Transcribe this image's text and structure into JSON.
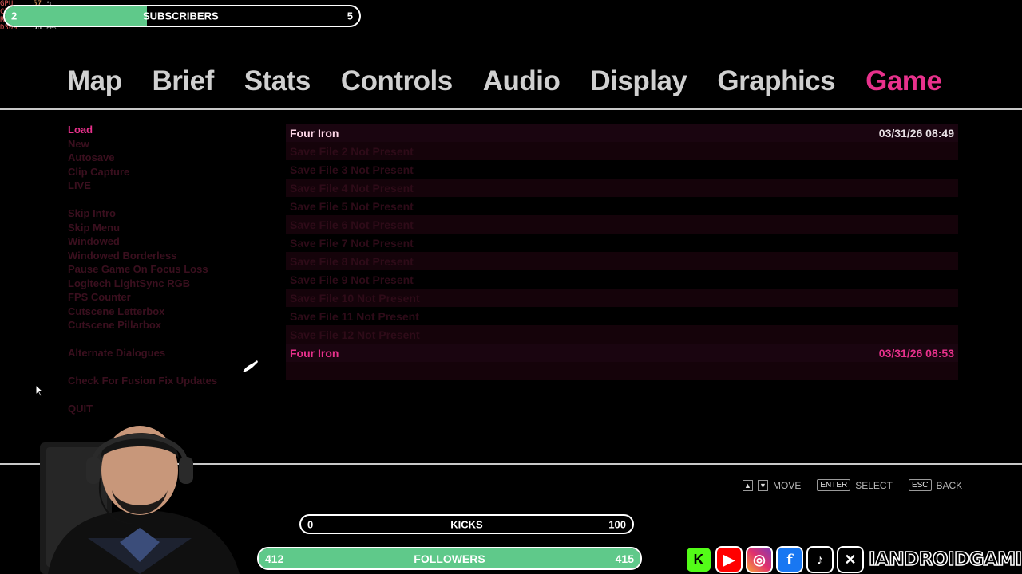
{
  "perf": [
    {
      "label": "GPU",
      "value": "57",
      "unit": "°C"
    },
    {
      "label": "CPU",
      "value": "75",
      "unit": "%"
    },
    {
      "label": "RAM",
      "value": "7518",
      "unit": "MB"
    },
    {
      "label": "D309",
      "value": "58",
      "unit": "FPS"
    }
  ],
  "subscribers": {
    "start": "2",
    "label": "SUBSCRIBERS",
    "end": "5",
    "progress": 0.4
  },
  "tabs": [
    {
      "label": "Map"
    },
    {
      "label": "Brief"
    },
    {
      "label": "Stats"
    },
    {
      "label": "Controls"
    },
    {
      "label": "Audio"
    },
    {
      "label": "Display"
    },
    {
      "label": "Graphics"
    },
    {
      "label": "Game",
      "active": true
    }
  ],
  "menu": {
    "group1": [
      "Load",
      "New",
      "Autosave",
      "Clip Capture",
      "LIVE"
    ],
    "group2": [
      "Skip Intro",
      "Skip Menu",
      "Windowed",
      "Windowed Borderless",
      "Pause Game On Focus Loss",
      "Logitech LightSync RGB",
      "FPS Counter",
      "Cutscene Letterbox",
      "Cutscene Pillarbox"
    ],
    "group3": [
      "Alternate Dialogues"
    ],
    "group4": [
      "Check For Fusion Fix Updates"
    ],
    "group5": [
      "QUIT"
    ]
  },
  "saves": [
    {
      "name": "Four Iron",
      "date": "03/31/26 08:49"
    },
    {
      "name": "Save File 2 Not Present",
      "date": ""
    },
    {
      "name": "Save File 3 Not Present",
      "date": ""
    },
    {
      "name": "Save File 4 Not Present",
      "date": ""
    },
    {
      "name": "Save File 5 Not Present",
      "date": ""
    },
    {
      "name": "Save File 6 Not Present",
      "date": ""
    },
    {
      "name": "Save File 7 Not Present",
      "date": ""
    },
    {
      "name": "Save File 8 Not Present",
      "date": ""
    },
    {
      "name": "Save File 9 Not Present",
      "date": ""
    },
    {
      "name": "Save File 10 Not Present",
      "date": ""
    },
    {
      "name": "Save File 11 Not Present",
      "date": ""
    },
    {
      "name": "Save File 12 Not Present",
      "date": ""
    },
    {
      "name": "Four Iron",
      "date": "03/31/26 08:53"
    },
    {
      "name": "",
      "date": ""
    },
    {
      "name": "",
      "date": ""
    }
  ],
  "hints": {
    "move": "MOVE",
    "enter_key": "ENTER",
    "select": "SELECT",
    "esc_key": "ESC",
    "back": "BACK"
  },
  "kicks": {
    "start": "0",
    "label": "KICKS",
    "end": "100",
    "progress": 0
  },
  "followers": {
    "start": "412",
    "label": "FOLLOWERS",
    "end": "415",
    "progress": 1.0
  },
  "social": {
    "handle": "IANDROIDGAMING",
    "icons": [
      "kick-icon",
      "youtube-icon",
      "instagram-icon",
      "facebook-icon",
      "tiktok-icon",
      "x-icon"
    ]
  },
  "colors": {
    "accent": "#e8318c",
    "goal_fill": "#5fc98a",
    "inactive_tab": "#d0d0d0"
  }
}
